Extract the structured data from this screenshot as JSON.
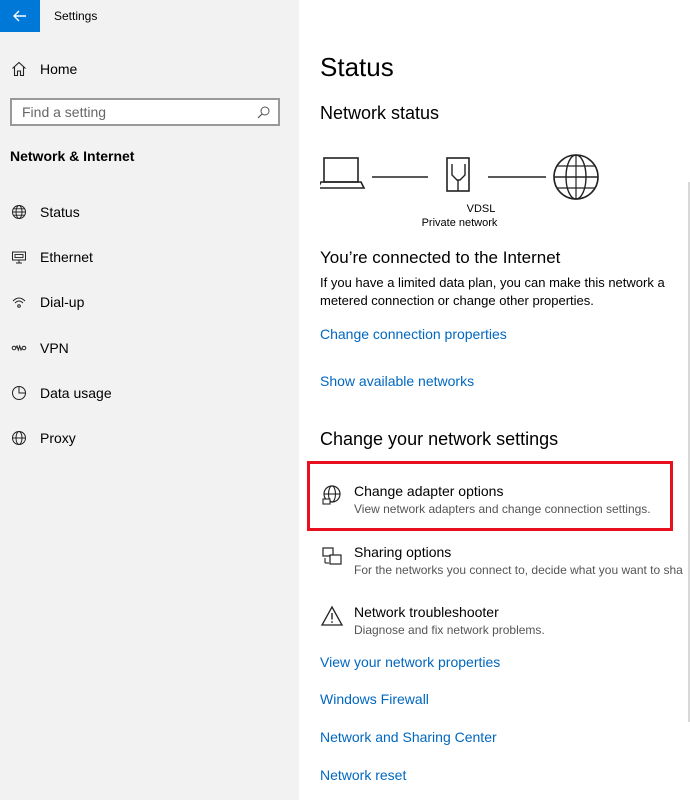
{
  "app": {
    "title": "Settings",
    "back_icon": "back-arrow-icon"
  },
  "sidebar": {
    "home_label": "Home",
    "search_placeholder": "Find a setting",
    "section_title": "Network & Internet",
    "items": [
      {
        "label": "Status",
        "icon": "globe-icon"
      },
      {
        "label": "Ethernet",
        "icon": "ethernet-icon"
      },
      {
        "label": "Dial-up",
        "icon": "dialup-icon"
      },
      {
        "label": "VPN",
        "icon": "vpn-icon"
      },
      {
        "label": "Data usage",
        "icon": "data-usage-icon"
      },
      {
        "label": "Proxy",
        "icon": "globe-icon"
      }
    ]
  },
  "main": {
    "title": "Status",
    "network_status_heading": "Network status",
    "diagram": {
      "adapter_name": "VDSL",
      "network_type": "Private network"
    },
    "connected_heading": "You’re connected to the Internet",
    "connected_desc_line1": "If you have a limited data plan, you can make this network a",
    "connected_desc_line2": "metered connection or change other properties.",
    "links_top": [
      "Change connection properties",
      "Show available networks"
    ],
    "change_heading": "Change your network settings",
    "options": [
      {
        "title": "Change adapter options",
        "desc": "View network adapters and change connection settings.",
        "icon": "adapter-globe-icon"
      },
      {
        "title": "Sharing options",
        "desc": "For the networks you connect to, decide what you want to sha",
        "icon": "sharing-icon"
      },
      {
        "title": "Network troubleshooter",
        "desc": "Diagnose and fix network problems.",
        "icon": "warning-icon"
      }
    ],
    "links_bottom": [
      "View your network properties",
      "Windows Firewall",
      "Network and Sharing Center",
      "Network reset"
    ]
  },
  "colors": {
    "accent": "#0078d7",
    "link": "#0067c0",
    "highlight": "#e8101f",
    "sidebar_bg": "#f2f2f2"
  }
}
